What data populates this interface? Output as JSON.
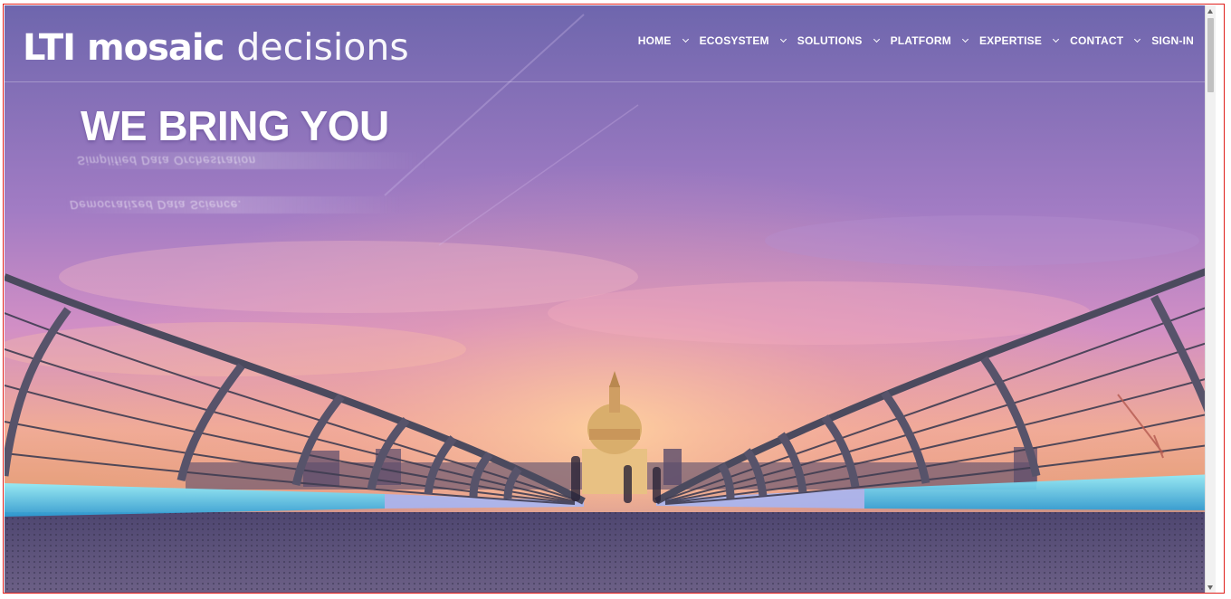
{
  "brand": {
    "logo_strong": "LTI mosaic",
    "logo_light": "decisions"
  },
  "nav": {
    "items": [
      {
        "label": "HOME",
        "has_dropdown": true
      },
      {
        "label": "ECOSYSTEM",
        "has_dropdown": true
      },
      {
        "label": "SOLUTIONS",
        "has_dropdown": true
      },
      {
        "label": "PLATFORM",
        "has_dropdown": true
      },
      {
        "label": "EXPERTISE",
        "has_dropdown": true
      },
      {
        "label": "CONTACT",
        "has_dropdown": true
      },
      {
        "label": "SIGN-IN",
        "has_dropdown": false
      }
    ]
  },
  "hero": {
    "headline": "WE BRING YOU",
    "tagline_1": "Simplified Data Orchestration",
    "tagline_2": "Democratized Data Science."
  },
  "colors": {
    "accent_frame": "#e0201c",
    "sky_top": "#7a6bb0",
    "sky_mid": "#c485c8",
    "sky_glow": "#f2b08a",
    "rail_light": "#4fd2f0"
  },
  "icons": {
    "dropdown": "chevron-down-icon"
  }
}
